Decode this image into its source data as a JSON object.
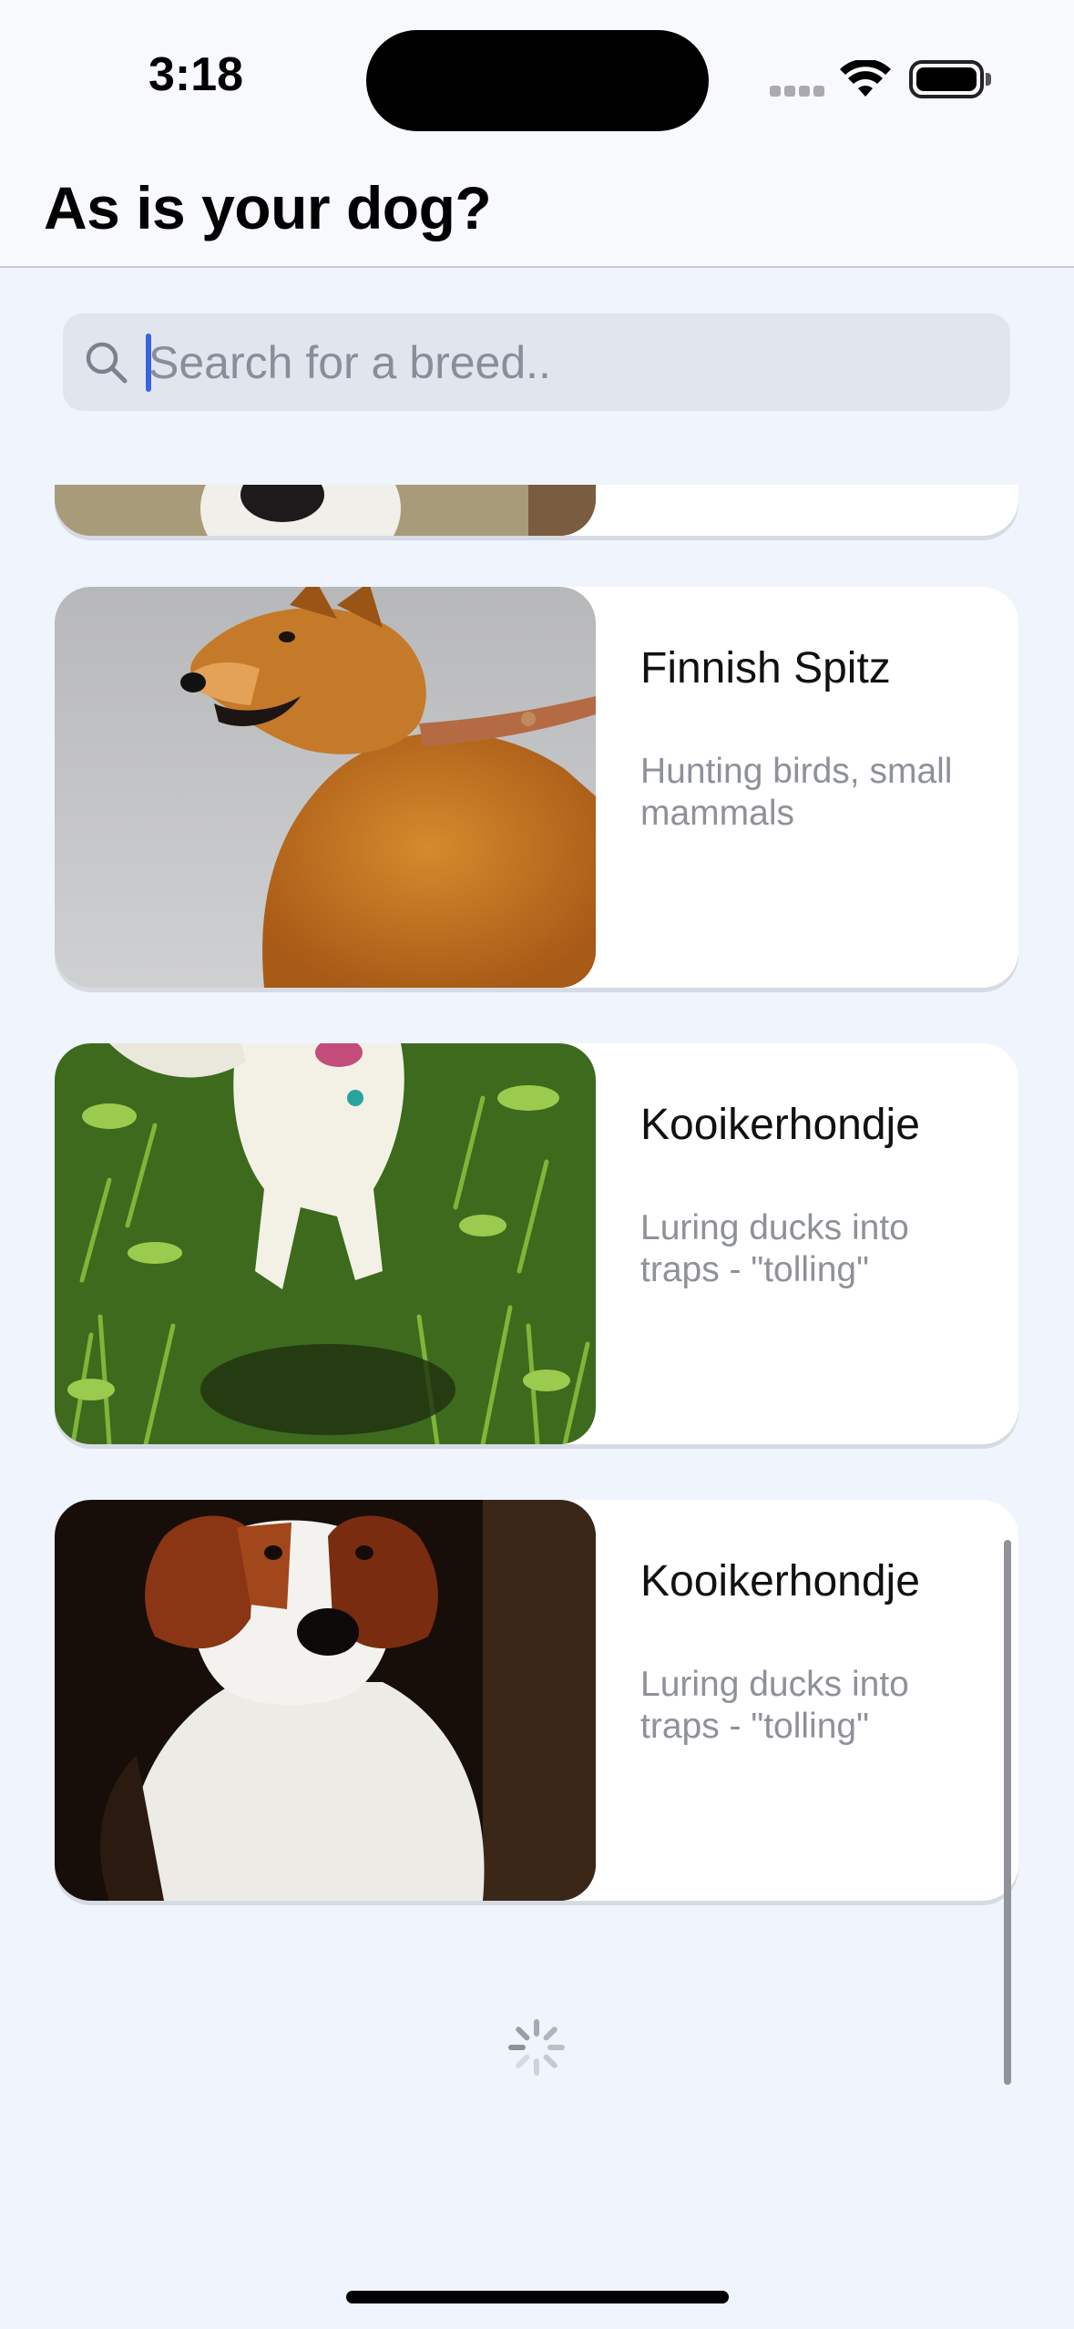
{
  "status_bar": {
    "time": "3:18"
  },
  "header": {
    "title": "As is your dog?"
  },
  "search": {
    "placeholder": "Search for a breed.."
  },
  "breeds": [
    {
      "name": "",
      "purpose": ""
    },
    {
      "name": "Finnish Spitz",
      "purpose": "Hunting birds, small mammals"
    },
    {
      "name": "Kooikerhondje",
      "purpose": "Luring ducks into traps - \"tolling\""
    },
    {
      "name": "Kooikerhondje",
      "purpose": "Luring ducks into traps - \"tolling\""
    }
  ],
  "icons": {
    "search": "search-icon",
    "spinner": "activity-spinner-icon",
    "wifi": "wifi-icon",
    "battery": "battery-icon",
    "signal": "cellular-signal-icon"
  },
  "colors": {
    "background": "#eff4fd",
    "card": "#ffffff",
    "accent_caret": "#3a63e0",
    "secondary_text": "#8e9198"
  }
}
